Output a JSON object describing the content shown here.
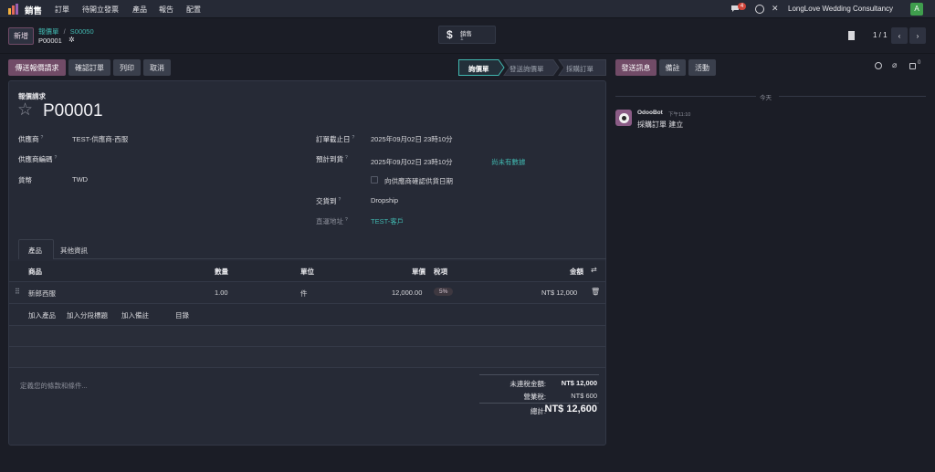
{
  "topbar": {
    "app_name": "銷售",
    "menu": [
      "訂單",
      "待開立發票",
      "產品",
      "報告",
      "配置"
    ],
    "chat_badge": "4",
    "company": "LongLove Wedding Consultancy",
    "avatar_letter": "A"
  },
  "control": {
    "new_label": "新增",
    "breadcrumb_parent": "報價單",
    "breadcrumb_sep": "/",
    "breadcrumb_current": "S00050",
    "record_name": "P00001",
    "smart_button_label": "銷售",
    "smart_button_count": "1",
    "pager": "1 / 1"
  },
  "actions": {
    "buttons": [
      "傳送報價請求",
      "確認訂單",
      "列印",
      "取消"
    ],
    "statusbar": [
      "詢價單",
      "發送詢價單",
      "採購訂單"
    ]
  },
  "form": {
    "title_label": "報價請求",
    "title": "P00001",
    "vendor_label": "供應商",
    "vendor": "TEST-供應商-西服",
    "vendor_ref_label": "供應商編碼",
    "currency_label": "貨幣",
    "currency": "TWD",
    "deadline_label": "訂單截止日",
    "deadline": "2025年09月02日 23時10分",
    "expected_label": "預計到貨",
    "expected": "2025年09月02日 23時10分",
    "expected_note": "尚未有數據",
    "confirm_checkbox_label": "向供應商確認供貨日期",
    "deliver_to_label": "交貨到",
    "deliver_to": "Dropship",
    "dropship_label": "直運地址",
    "dropship": "TEST-客戶"
  },
  "tabs": [
    "產品",
    "其他資訊"
  ],
  "lines": {
    "headers": {
      "product": "商品",
      "qty": "數量",
      "uom": "單位",
      "price": "單價",
      "tax": "稅項",
      "amount": "金額"
    },
    "rows": [
      {
        "product": "新郎西服",
        "qty": "1.00",
        "uom": "件",
        "price": "12,000.00",
        "tax": "5%",
        "amount": "NT$ 12,000"
      }
    ],
    "add_links": [
      "加入產品",
      "加入分段標題",
      "加入備註",
      "目錄"
    ]
  },
  "terms_placeholder": "定義您的條款和條件...",
  "totals": {
    "untaxed_label": "未連稅金額:",
    "untaxed": "NT$ 12,000",
    "tax_label": "營業稅:",
    "tax": "NT$ 600",
    "total_label": "總計:",
    "total": "NT$ 12,600"
  },
  "chatter": {
    "buttons": [
      "發送訊息",
      "備註",
      "活動"
    ],
    "date_sep": "今天",
    "author": "OdooBot",
    "time": "下午11:10",
    "message": "採購訂單 建立",
    "follower_count": "0"
  },
  "colors": {
    "primary": "#714b67",
    "link": "#41b8b0",
    "background": "#1b1d26",
    "card": "#262a36"
  }
}
